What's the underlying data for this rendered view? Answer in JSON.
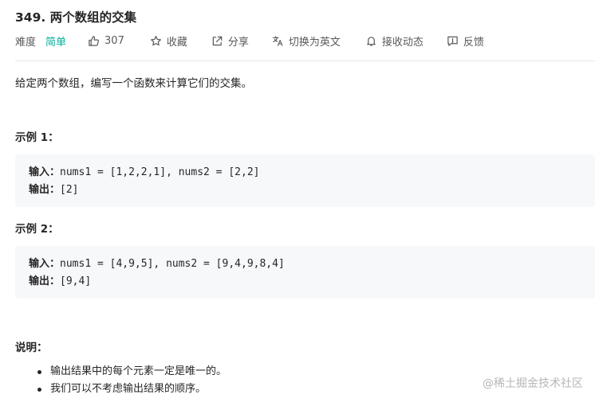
{
  "problem": {
    "title": "349. 两个数组的交集"
  },
  "toolbar": {
    "difficulty_label": "难度",
    "difficulty_value": "简单",
    "likes": "307",
    "favorite_label": "收藏",
    "share_label": "分享",
    "switch_lang_label": "切换为英文",
    "notify_label": "接收动态",
    "feedback_label": "反馈",
    "icons": [
      "thumbs-up-icon",
      "star-icon",
      "share-icon",
      "translate-icon",
      "bell-icon",
      "feedback-icon"
    ]
  },
  "description": "给定两个数组，编写一个函数来计算它们的交集。",
  "examples": [
    {
      "title": "示例 1：",
      "input_label": "输入：",
      "input_value": "nums1 = [1,2,2,1], nums2 = [2,2]",
      "output_label": "输出：",
      "output_value": "[2]"
    },
    {
      "title": "示例 2：",
      "input_label": "输入：",
      "input_value": "nums1 = [4,9,5], nums2 = [9,4,9,8,4]",
      "output_label": "输出：",
      "output_value": "[9,4]"
    }
  ],
  "notes": {
    "title": "说明：",
    "items": [
      "输出结果中的每个元素一定是唯一的。",
      "我们可以不考虑输出结果的顺序。"
    ]
  },
  "watermark": "@稀土掘金技术社区",
  "colors": {
    "easy": "#00af9b",
    "text": "#262626",
    "muted": "#595959",
    "code_bg": "#f7f8fa"
  }
}
